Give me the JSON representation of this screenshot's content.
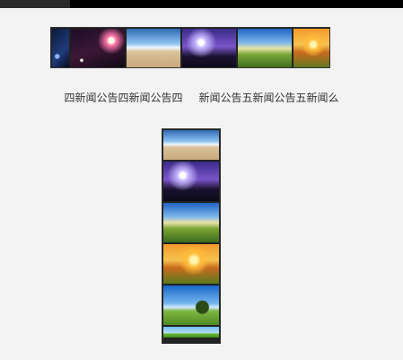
{
  "marquee": {
    "segments": [
      "四新闻公告四新闻公告四",
      "新闻公告五新闻公告五新闻么"
    ]
  },
  "strip_top": {
    "images": [
      "space-icon",
      "planet-icon",
      "beach-icon",
      "purple-sky-icon",
      "field-icon",
      "sunset-icon"
    ]
  },
  "strip_vertical": {
    "images": [
      "beach-icon",
      "purple-sky-icon",
      "field-icon",
      "sunset-icon",
      "tree-icon",
      "grass-icon"
    ]
  }
}
